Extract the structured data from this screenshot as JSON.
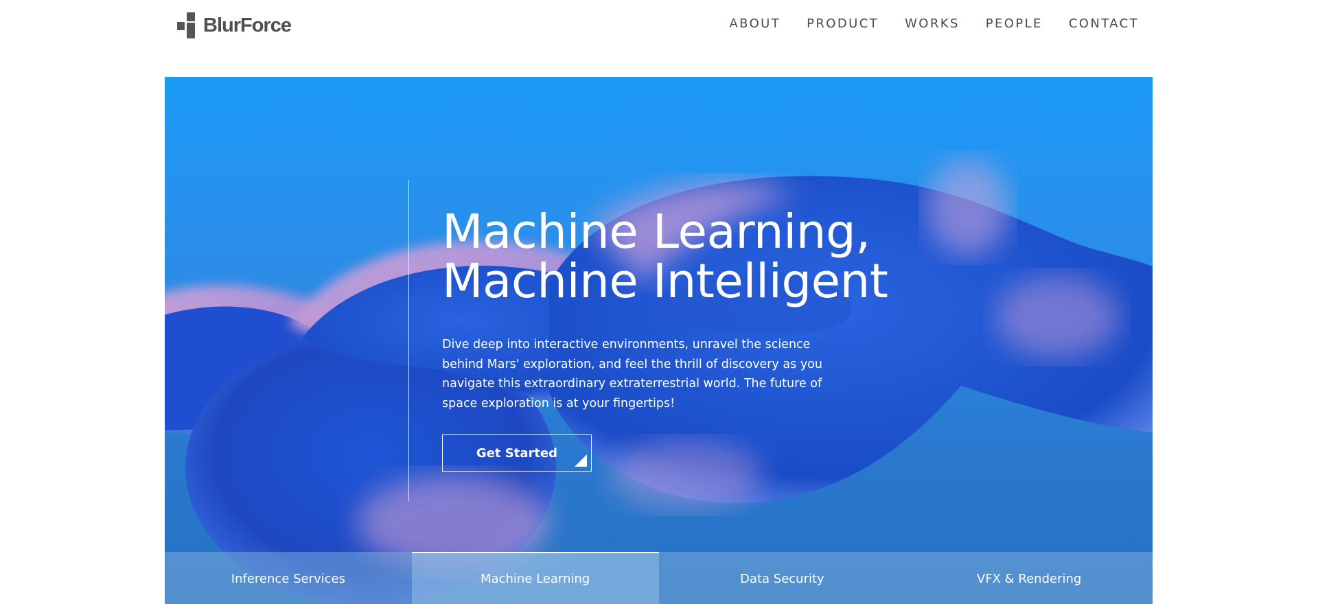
{
  "brand": {
    "name": "BlurForce",
    "logo_icon": "blocks-logo-icon"
  },
  "nav": {
    "items": [
      {
        "label": "ABOUT"
      },
      {
        "label": "PRODUCT"
      },
      {
        "label": "WORKS"
      },
      {
        "label": "PEOPLE"
      },
      {
        "label": "CONTACT"
      }
    ]
  },
  "hero": {
    "title_line1": "Machine Learning,",
    "title_line2": "Machine Intelligent",
    "description": "Dive deep into interactive environments, unravel the science behind Mars' exploration, and feel the thrill of discovery as you navigate this extraordinary extraterrestrial world. The future of space exploration is at your fingertips!",
    "cta_label": "Get Started",
    "cta_icon": "corner-triangle-icon"
  },
  "tabs": [
    {
      "label": "Inference Services",
      "active": false
    },
    {
      "label": "Machine Learning",
      "active": true
    },
    {
      "label": "Data Security",
      "active": false
    },
    {
      "label": "VFX & Rendering",
      "active": false
    }
  ],
  "colors": {
    "hero_top": "#1b9af7",
    "hero_bottom": "#2671c4",
    "shape_blue": "#1f4fc9",
    "shape_pink": "#c9a0d6",
    "nav_text": "#4a4a4a",
    "logo_text": "#4f4f4f"
  }
}
